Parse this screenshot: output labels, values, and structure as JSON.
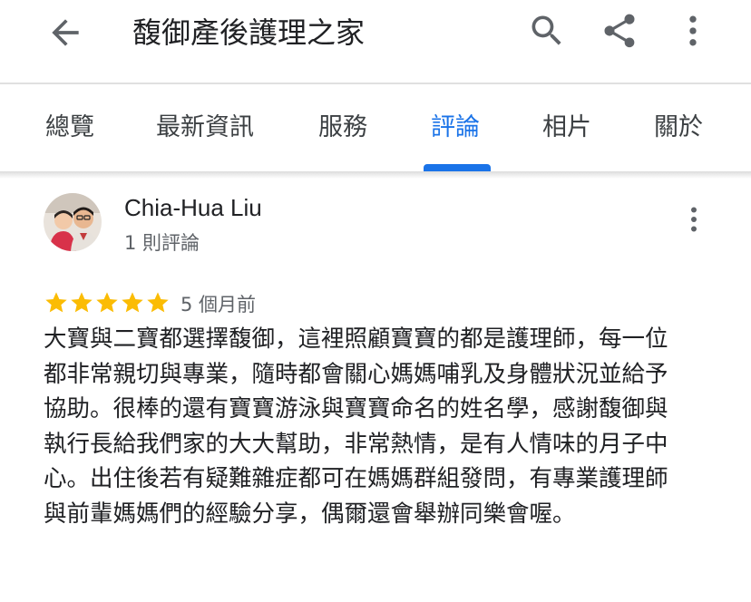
{
  "appbar": {
    "title": "馥御產後護理之家",
    "back_icon": "arrow-left-icon",
    "search_icon": "search-icon",
    "share_icon": "share-icon",
    "more_icon": "more-vert-icon"
  },
  "tabs": [
    {
      "label": "總覽",
      "active": false
    },
    {
      "label": "最新資訊",
      "active": false
    },
    {
      "label": "服務",
      "active": false
    },
    {
      "label": "評論",
      "active": true
    },
    {
      "label": "相片",
      "active": false
    },
    {
      "label": "關於",
      "active": false
    }
  ],
  "review": {
    "author": "Chia-Hua Liu",
    "author_meta": "1 則評論",
    "rating": 5,
    "max_rating": 5,
    "time": "5 個月前",
    "text": "大寶與二寶都選擇馥御，這裡照顧寶寶的都是護理師，每一位都非常親切與專業，隨時都會關心媽媽哺乳及身體狀況並給予協助。很棒的還有寶寶游泳與寶寶命名的姓名學，感謝馥御與執行長給我們家的大大幫助，非常熱情，是有人情味的月子中心。出住後若有疑難雜症都可在媽媽群組發問，有專業護理師與前輩媽媽們的經驗分享，偶爾還會舉辦同樂會喔。"
  },
  "colors": {
    "accent": "#1a73e8",
    "star": "#fbbc04",
    "text": "#202124",
    "secondary_text": "#5f6368",
    "icon": "#5f6368"
  }
}
